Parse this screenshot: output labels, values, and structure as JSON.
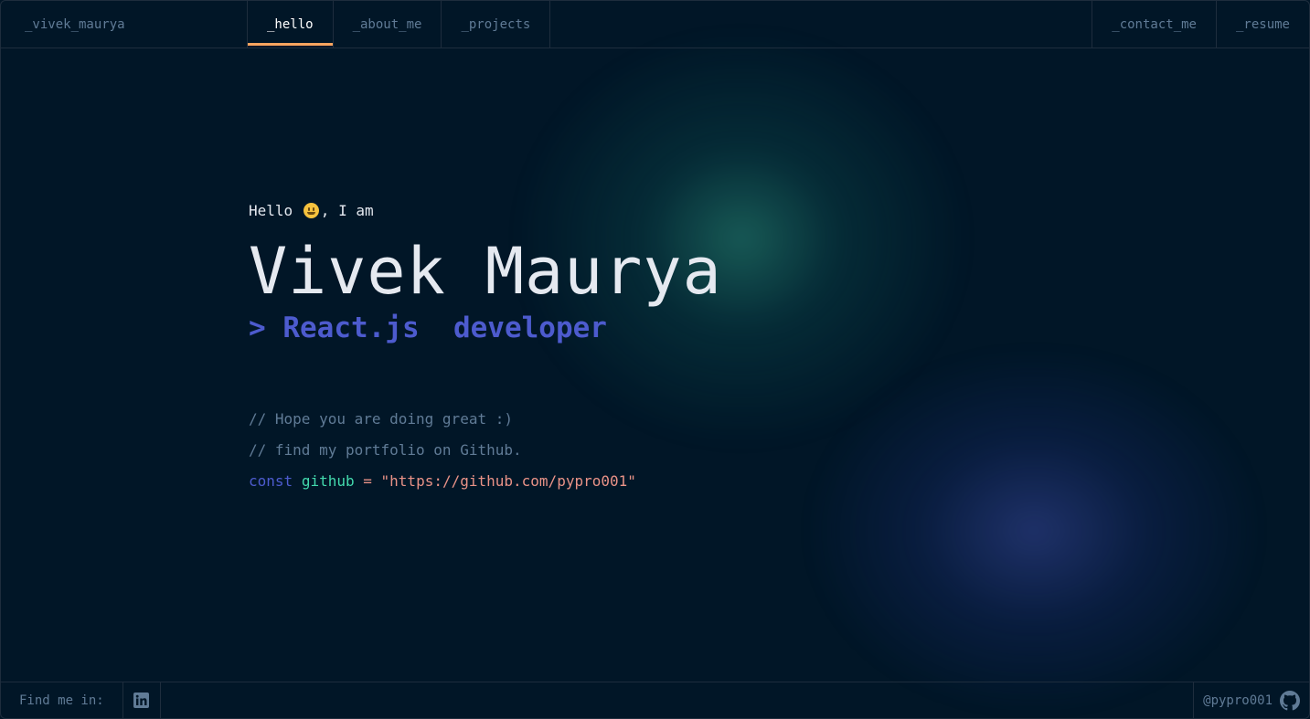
{
  "header": {
    "brand": "_vivek_maurya",
    "nav": [
      "_hello",
      "_about_me",
      "_projects"
    ],
    "right_nav": [
      "_contact_me",
      "_resume"
    ]
  },
  "hero": {
    "greeting_before": "Hello ",
    "greeting_after": ", I am",
    "name": "Vivek Maurya",
    "role": "> React.js  developer",
    "comments": [
      "// Hope you are doing great :)",
      "// find my portfolio on Github."
    ],
    "code": {
      "keyword": "const",
      "variable": "github",
      "operator": "=",
      "value": "\"https://github.com/pypro001\""
    }
  },
  "footer": {
    "find_label": "Find me in:",
    "handle": "@pypro001"
  },
  "icons": [
    "emoji-grinning-icon",
    "linkedin-icon",
    "github-icon"
  ],
  "colors": {
    "background": "#011627",
    "border": "#1e2d3d",
    "text_muted": "#607b96",
    "accent_orange": "#fea55f",
    "accent_blue": "#4d5bce",
    "accent_green": "#43d9ad",
    "accent_pink": "#e99287"
  }
}
